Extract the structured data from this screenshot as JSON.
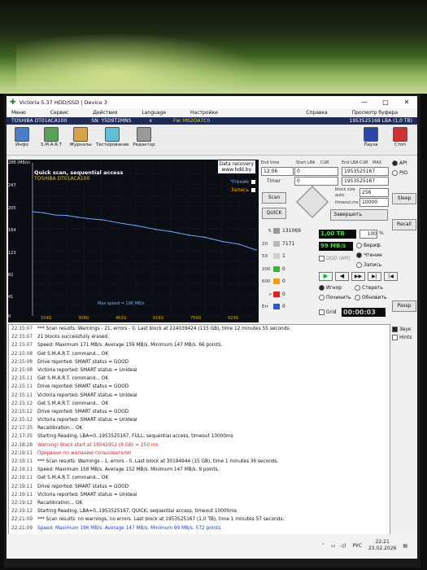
{
  "window": {
    "title": "Victoria 5.37 HDD/SSD | Device 3",
    "controls": [
      "—",
      "□",
      "✕"
    ]
  },
  "menu": {
    "items": [
      "Меню",
      "Сервис",
      "Действия",
      "Language",
      "Настройки"
    ],
    "right_items": [
      "Справка",
      "Просмотр буфера"
    ]
  },
  "drive_info": {
    "model": "TOSHIBA DT01ACA100",
    "serial": "SN: Y5D9T2MNS",
    "close": "x",
    "firmware": "Fw: MS2OA7C0",
    "lba": "1953525168 LBA (1,0 TB)"
  },
  "toolbar": {
    "buttons": [
      "Инфо",
      "S.M.A.R.T",
      "Журналы",
      "Тестирование",
      "Редактор"
    ],
    "pause": "Пауза",
    "stop": "Cтоп"
  },
  "graph": {
    "title": "Quick scan, sequential access",
    "subtitle": "TOSHIBA DT01ACA100",
    "data_recovery": "Data recovery",
    "url": "www.hdd.by",
    "legend_read": "Чтение",
    "legend_write": "Запись",
    "max_speed": "Max speed = 196 MB/s",
    "y_ticks": [
      "288 (MB/s)",
      "247",
      "205",
      "164",
      "123",
      "82",
      "41",
      "0"
    ],
    "x_ticks": [
      "154G",
      "308G",
      "462G",
      "616G",
      "769G",
      "923G"
    ]
  },
  "chart_data": {
    "type": "line",
    "title": "Quick scan, sequential access",
    "series": [
      {
        "name": "Чтение",
        "x": [
          0,
          50,
          100,
          154,
          200,
          250,
          308,
          350,
          400,
          462,
          500,
          550,
          616,
          650,
          700,
          769,
          800,
          850,
          923,
          1000
        ],
        "values": [
          196,
          194,
          190,
          189,
          186,
          183,
          181,
          178,
          174,
          170,
          167,
          163,
          159,
          156,
          152,
          148,
          145,
          140,
          135,
          124
        ]
      }
    ],
    "xlim": [
      0,
      1000
    ],
    "ylim": [
      0,
      288
    ],
    "xlabel": "",
    "ylabel": "MB/s",
    "grid": true
  },
  "panel": {
    "end_time_label": "End time",
    "start_lba_label": "Start LBA",
    "cur_label": "CUR",
    "end_lba_label": "End LBA",
    "max_label": "MAX",
    "time_value": "12:06",
    "start_lba_value": "0",
    "start_lba_cur": "0",
    "end_lba_value": "1953525167",
    "end_lba_cur": "1953525167",
    "timer_label": "Timer",
    "block_size_label": "block size",
    "auto_label": "auto",
    "timeout_label": "timeout,ms",
    "block_size": "256",
    "timeout": "10000",
    "scan_button": "Scan",
    "quick_button": "QUICK",
    "action": "Завершить",
    "blocks": [
      {
        "label": "5",
        "count": "131069",
        "color": "#9a9a9a"
      },
      {
        "label": "20",
        "count": "7171",
        "color": "#b8b8b8"
      },
      {
        "label": "50",
        "count": "1",
        "color": "#d0d0d0"
      },
      {
        "label": "200",
        "count": "0",
        "color": "#33b633"
      },
      {
        "label": "600",
        "count": "0",
        "color": "#f19a1e"
      },
      {
        "label": ">",
        "count": "0",
        "color": "#e02020"
      },
      {
        "label": "Err",
        "count": "0",
        "color": "#2b53d8"
      }
    ],
    "size_done": "1,00 TB",
    "percent": "100",
    "percent_sign": "%",
    "speed": "99 MB/s",
    "verify_label": "Вериф.",
    "read_label": "Чтение",
    "write_label": "Запись",
    "ddd_label": "DDD (API)",
    "ignore_label": "Игнор",
    "erase_label": "Стереть",
    "repair_label": "Починить",
    "update_label": "Обновить",
    "grid_label": "Grid",
    "elapsed": "00:00:03"
  },
  "sidebar": {
    "api": "API",
    "pio": "PIO",
    "sleep": "Sleep",
    "recall": "Recall",
    "passp": "Passp"
  },
  "log": {
    "rows": [
      {
        "time": "22:15:07",
        "msg": "*** Scan results: Warnings - 21, errors - 0. Last block at 224039424 (115 GB), time 12 minutes 55 seconds.",
        "style": ""
      },
      {
        "time": "22:15:07",
        "msg": "21 blocks successfully erased.",
        "style": ""
      },
      {
        "time": "22:15:07",
        "msg": "Speed: Maximum 171 MB/s. Average 159 MB/s. Minimum 147 MB/s. 66 points.",
        "style": ""
      },
      {
        "time": "22:15:08",
        "msg": "Get S.M.A.R.T. command... OK",
        "style": ""
      },
      {
        "time": "22:15:08",
        "msg": "Drive reported: SMART status = GOOD",
        "style": ""
      },
      {
        "time": "22:15:08",
        "msg": "Victoria reported: SMART status = Unideal",
        "style": ""
      },
      {
        "time": "22:15:11",
        "msg": "Get S.M.A.R.T. command... OK",
        "style": ""
      },
      {
        "time": "22:15:11",
        "msg": "Drive reported: SMART status = GOOD",
        "style": ""
      },
      {
        "time": "22:15:11",
        "msg": "Victoria reported: SMART status = Unideal",
        "style": ""
      },
      {
        "time": "22:15:12",
        "msg": "Get S.M.A.R.T. command... OK",
        "style": ""
      },
      {
        "time": "22:15:12",
        "msg": "Drive reported: SMART status = GOOD",
        "style": ""
      },
      {
        "time": "22:15:12",
        "msg": "Victoria reported: SMART status = Unideal",
        "style": ""
      },
      {
        "time": "22:17:35",
        "msg": "Recallibration... OK",
        "style": ""
      },
      {
        "time": "22:17:35",
        "msg": "Starting Reading, LBA=0..1953525167, FULL, sequential access, timeout 10000ms",
        "style": ""
      },
      {
        "time": "22:18:28",
        "msg": "Warning! Block start at 16541952 (8 GB) = 250 ms",
        "style": "warn"
      },
      {
        "time": "22:19:11",
        "msg": "Прервано по желанию пользователя!",
        "style": "warn"
      },
      {
        "time": "22:19:11",
        "msg": "*** Scan results: Warnings - 1, errors - 0. Last block at 30194944 (15 GB), time 1 minutes 36 seconds.",
        "style": ""
      },
      {
        "time": "22:19:11",
        "msg": "Speed: Maximum 158 MB/s. Average 152 MB/s. Minimum 147 MB/s. 9 points.",
        "style": ""
      },
      {
        "time": "22:19:11",
        "msg": "Get S.M.A.R.T. command... OK",
        "style": ""
      },
      {
        "time": "22:19:11",
        "msg": "Drive reported: SMART status = GOOD",
        "style": ""
      },
      {
        "time": "22:19:11",
        "msg": "Victoria reported: SMART status = Unideal",
        "style": ""
      },
      {
        "time": "22:19:12",
        "msg": "Recallibration... OK",
        "style": ""
      },
      {
        "time": "22:19:12",
        "msg": "Starting Reading, LBA=0..1953525167, QUICK, sequential access, timeout 10000ms",
        "style": ""
      },
      {
        "time": "22:21:09",
        "msg": "*** Scan results: no warnings, no errors. Last block at 1953525167 (1,0 TB), time 1 minutes 57 seconds.",
        "style": ""
      },
      {
        "time": "22:21:09",
        "msg": "Speed: Maximum 196 MB/s. Average 147 MB/s. Minimum 99 MB/s. 572 points.",
        "style": "blue"
      }
    ],
    "sound_label": "Звук",
    "hints_label": "Hints"
  },
  "taskbar": {
    "lang": "РУС",
    "time": "22:21",
    "date": "23.02.2026"
  }
}
